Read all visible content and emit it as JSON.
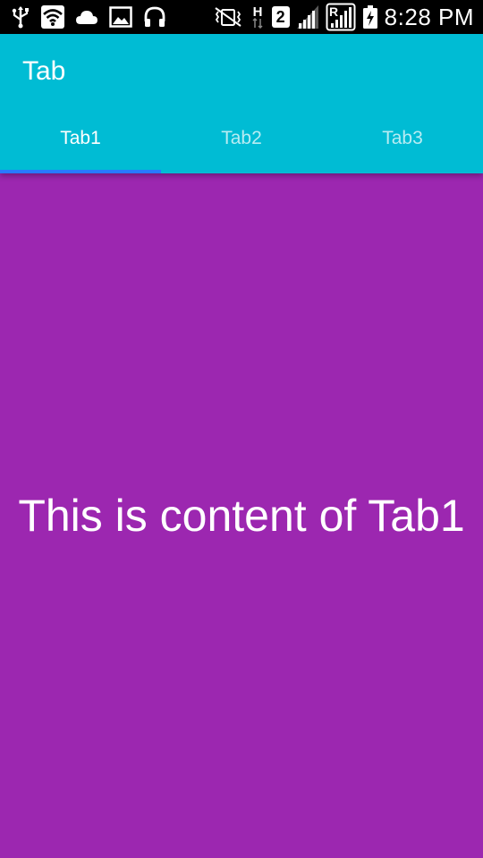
{
  "status_bar": {
    "left_icons": [
      "usb-icon",
      "wifi-icon",
      "cloud-icon",
      "image-icon",
      "headphones-icon"
    ],
    "right_icons": [
      "vibrate-icon",
      "h-data-icon",
      "sim2-icon",
      "signal-icon",
      "roaming-signal-icon",
      "battery-charging-icon"
    ],
    "sim_number": "2",
    "network_type": "H",
    "roaming_label": "R",
    "time": "8:28 PM"
  },
  "app_bar": {
    "title": "Tab",
    "color": "#00bcd4"
  },
  "tabs": [
    {
      "label": "Tab1",
      "selected": true
    },
    {
      "label": "Tab2",
      "selected": false
    },
    {
      "label": "Tab3",
      "selected": false
    }
  ],
  "tab_indicator_color": "#2979ff",
  "content": {
    "text": "This is content of Tab1",
    "background": "#9c27b0"
  }
}
